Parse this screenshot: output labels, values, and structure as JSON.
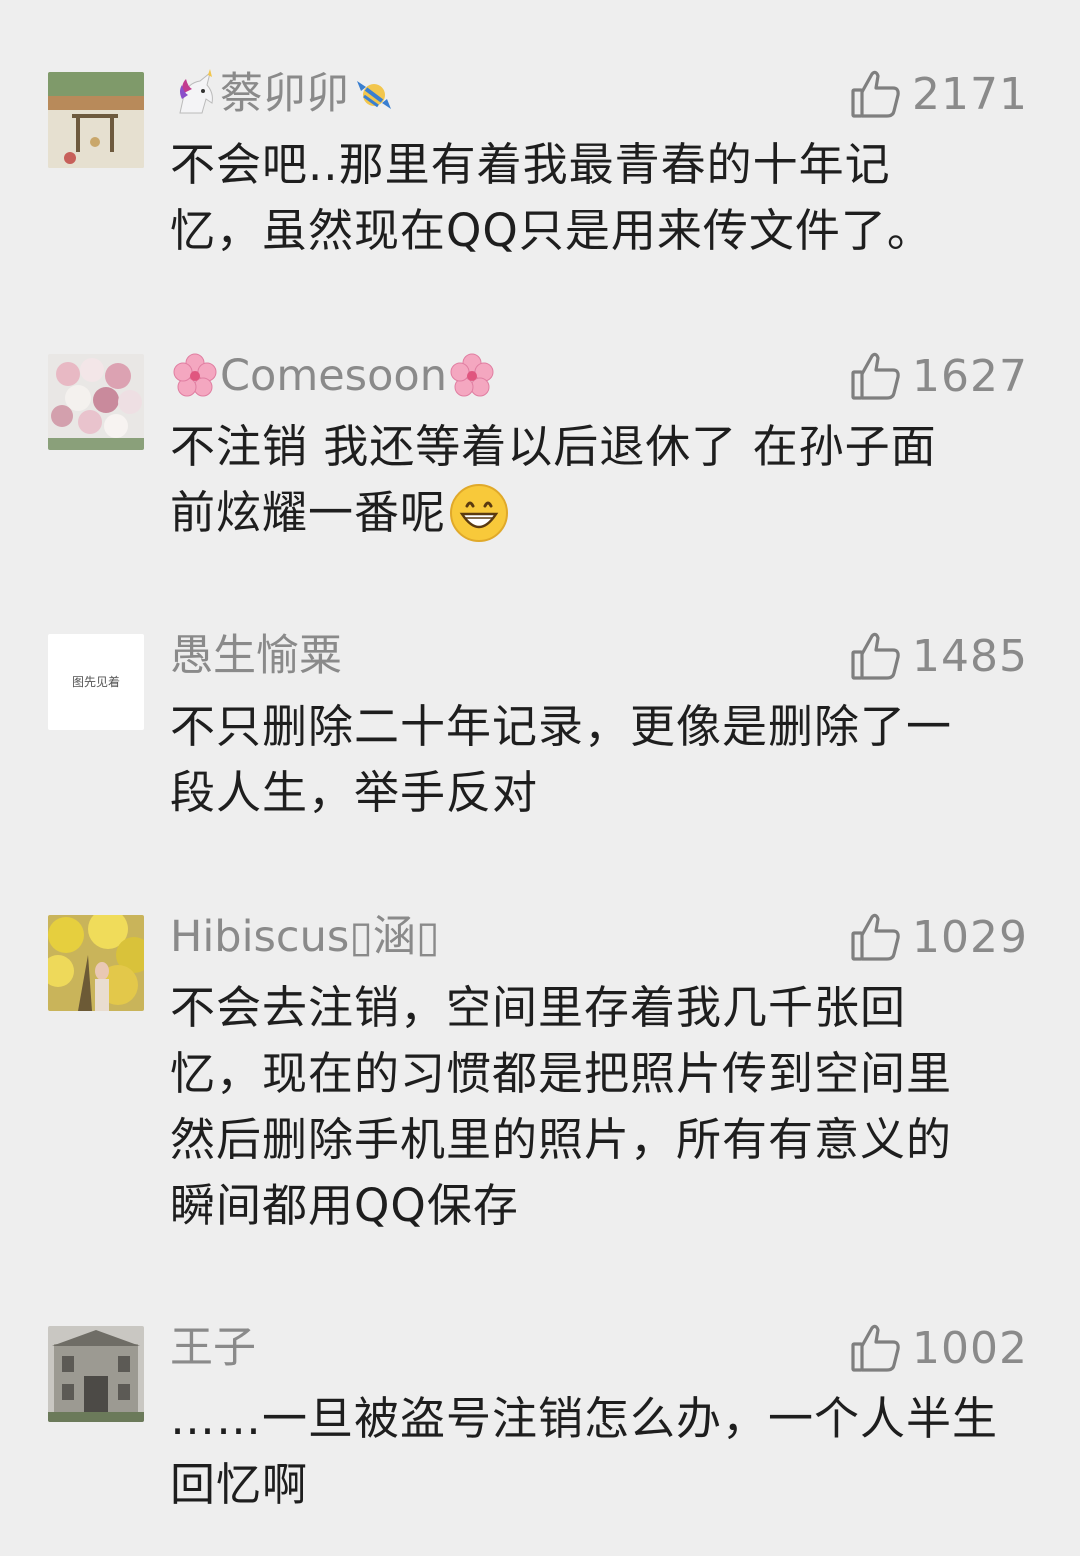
{
  "comments": [
    {
      "avatar": "photo-avatar-outdoor-scene",
      "name": "蔡卯卯",
      "name_prefix_emoji": "unicorn-emoji",
      "name_suffix_emoji": "candy-emoji",
      "likes": "2171",
      "lines": [
        "不会吧..那里有着我最青春的十年记",
        "忆，虽然现在QQ只是用来传文件了。"
      ]
    },
    {
      "avatar": "photo-avatar-flower-bouquet",
      "name": "Comesoon",
      "name_prefix_emoji": "cherry-blossom-emoji",
      "name_suffix_emoji": "cherry-blossom-emoji",
      "likes": "1627",
      "lines": [
        "不注销 我还等着以后退休了 在孙子面",
        "前炫耀一番呢"
      ],
      "line_suffix_emoji": "grinning-face-emoji"
    },
    {
      "avatar": "text-avatar",
      "avatar_text": "图先见着",
      "name": "愚生愉粟",
      "likes": "1485",
      "lines": [
        "不只删除二十年记录，更像是删除了一",
        "段人生，举手反对"
      ]
    },
    {
      "avatar": "photo-avatar-yellow-tree",
      "name": "Hibiscus\u0000涵\u0000",
      "name_display": "Hibiscus▯涵▯",
      "likes": "1029",
      "lines": [
        "不会去注销，空间里存着我几千张回",
        "忆，现在的习惯都是把照片传到空间里",
        "然后删除手机里的照片，所有有意义的",
        "瞬间都用QQ保存"
      ]
    },
    {
      "avatar": "photo-avatar-building",
      "name": "王子",
      "likes": "1002",
      "lines": [
        "……一旦被盗号注销怎么办，一个人半生",
        "回忆啊"
      ]
    }
  ],
  "colors": {
    "background": "#eeeeee",
    "name": "#8a8a8a",
    "text": "#1e1e1e",
    "likes": "#8a8a8a"
  },
  "icons": {
    "like": "thumbs-up-icon"
  }
}
